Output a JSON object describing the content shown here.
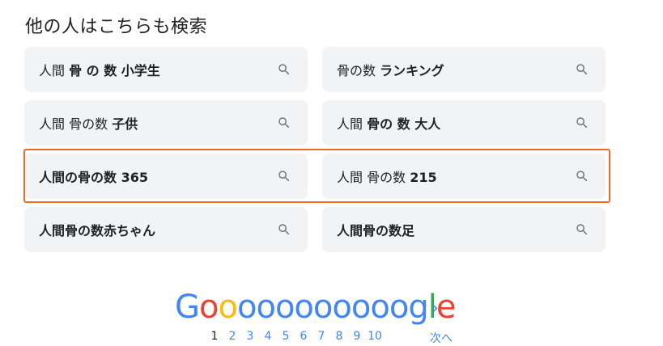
{
  "heading": "他の人はこちらも検索",
  "suggestions": [
    {
      "plain": "人間 ",
      "bold": "骨 の 数 小学生"
    },
    {
      "plain": "骨の数 ",
      "bold": "ランキング"
    },
    {
      "plain": "人間 骨の数 ",
      "bold": "子供"
    },
    {
      "plain": "人間 ",
      "bold": "骨の 数 大人"
    },
    {
      "plain": "",
      "bold": "人間の骨の数 365"
    },
    {
      "plain": "人間 骨の数 ",
      "bold": "215"
    },
    {
      "plain": "",
      "bold": "人間骨の数赤ちゃん"
    },
    {
      "plain": "",
      "bold": "人間骨の数足"
    }
  ],
  "pagination": {
    "logo_letters": [
      "G",
      "o",
      "o",
      "o",
      "o",
      "o",
      "o",
      "o",
      "o",
      "o",
      "o",
      "o",
      "g",
      "l",
      "e"
    ],
    "logo_colors": [
      "#4285f4",
      "#ea4335",
      "#fbbc05",
      "#4285f4",
      "#4285f4",
      "#4285f4",
      "#4285f4",
      "#4285f4",
      "#4285f4",
      "#4285f4",
      "#4285f4",
      "#4285f4",
      "#4285f4",
      "#34a853",
      "#ea4335"
    ],
    "pages": [
      "1",
      "2",
      "3",
      "4",
      "5",
      "6",
      "7",
      "8",
      "9",
      "10"
    ],
    "current_page": "1",
    "next_label": "次へ",
    "next_chevron": "›"
  },
  "colors": {
    "highlight": "#f26a2a",
    "chip_bg": "#f1f3f4"
  }
}
